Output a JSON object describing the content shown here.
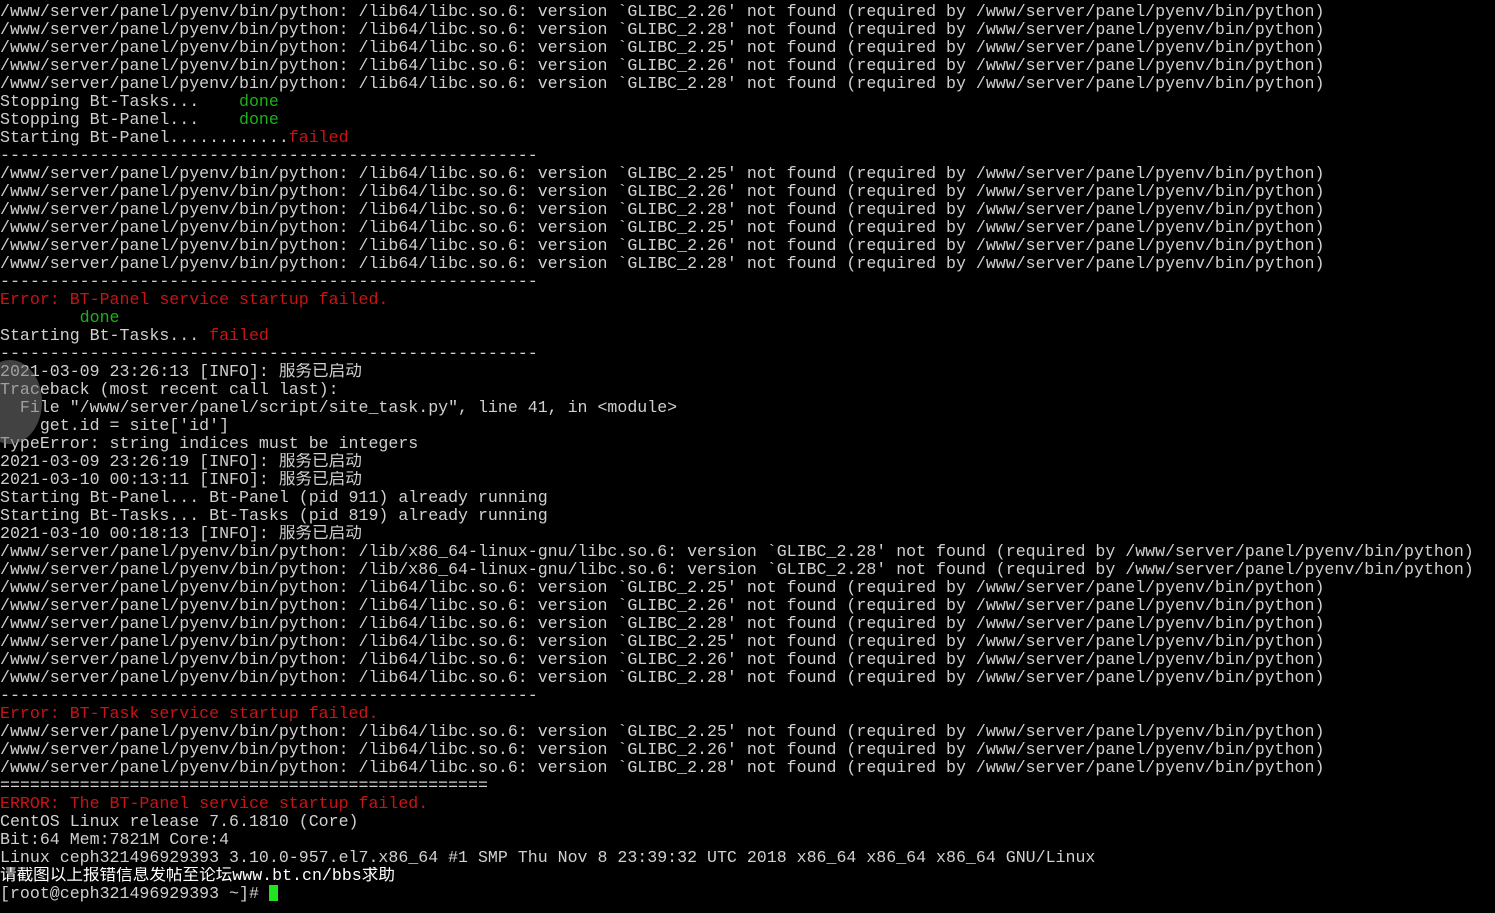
{
  "terminal": {
    "prompt": "[root@ceph321496929393 ~]# ",
    "lines": [
      [
        {
          "t": "/www/server/panel/pyenv/bin/python: /lib64/libc.so.6: version `GLIBC_2.26' not found (required by /www/server/panel/pyenv/bin/python)",
          "c": "default"
        }
      ],
      [
        {
          "t": "/www/server/panel/pyenv/bin/python: /lib64/libc.so.6: version `GLIBC_2.28' not found (required by /www/server/panel/pyenv/bin/python)",
          "c": "default"
        }
      ],
      [
        {
          "t": "/www/server/panel/pyenv/bin/python: /lib64/libc.so.6: version `GLIBC_2.25' not found (required by /www/server/panel/pyenv/bin/python)",
          "c": "default"
        }
      ],
      [
        {
          "t": "/www/server/panel/pyenv/bin/python: /lib64/libc.so.6: version `GLIBC_2.26' not found (required by /www/server/panel/pyenv/bin/python)",
          "c": "default"
        }
      ],
      [
        {
          "t": "/www/server/panel/pyenv/bin/python: /lib64/libc.so.6: version `GLIBC_2.28' not found (required by /www/server/panel/pyenv/bin/python)",
          "c": "default"
        }
      ],
      [
        {
          "t": "Stopping Bt-Tasks...    ",
          "c": "default"
        },
        {
          "t": "done",
          "c": "green"
        }
      ],
      [
        {
          "t": "Stopping Bt-Panel...    ",
          "c": "default"
        },
        {
          "t": "done",
          "c": "green"
        }
      ],
      [
        {
          "t": "Starting Bt-Panel............",
          "c": "default"
        },
        {
          "t": "failed",
          "c": "red"
        }
      ],
      [
        {
          "t": "------------------------------------------------------",
          "c": "default"
        }
      ],
      [
        {
          "t": "/www/server/panel/pyenv/bin/python: /lib64/libc.so.6: version `GLIBC_2.25' not found (required by /www/server/panel/pyenv/bin/python)",
          "c": "default"
        }
      ],
      [
        {
          "t": "/www/server/panel/pyenv/bin/python: /lib64/libc.so.6: version `GLIBC_2.26' not found (required by /www/server/panel/pyenv/bin/python)",
          "c": "default"
        }
      ],
      [
        {
          "t": "/www/server/panel/pyenv/bin/python: /lib64/libc.so.6: version `GLIBC_2.28' not found (required by /www/server/panel/pyenv/bin/python)",
          "c": "default"
        }
      ],
      [
        {
          "t": "/www/server/panel/pyenv/bin/python: /lib64/libc.so.6: version `GLIBC_2.25' not found (required by /www/server/panel/pyenv/bin/python)",
          "c": "default"
        }
      ],
      [
        {
          "t": "/www/server/panel/pyenv/bin/python: /lib64/libc.so.6: version `GLIBC_2.26' not found (required by /www/server/panel/pyenv/bin/python)",
          "c": "default"
        }
      ],
      [
        {
          "t": "/www/server/panel/pyenv/bin/python: /lib64/libc.so.6: version `GLIBC_2.28' not found (required by /www/server/panel/pyenv/bin/python)",
          "c": "default"
        }
      ],
      [
        {
          "t": "------------------------------------------------------",
          "c": "default"
        }
      ],
      [
        {
          "t": "Error: BT-Panel service startup failed.",
          "c": "red"
        }
      ],
      [
        {
          "t": "        ",
          "c": "default"
        },
        {
          "t": "done",
          "c": "green"
        }
      ],
      [
        {
          "t": "Starting Bt-Tasks... ",
          "c": "default"
        },
        {
          "t": "failed",
          "c": "red"
        }
      ],
      [
        {
          "t": "------------------------------------------------------",
          "c": "default"
        }
      ],
      [
        {
          "t": "2021-03-09 23:26:13 [INFO]: 服务已启动",
          "c": "default"
        }
      ],
      [
        {
          "t": "Traceback (most recent call last):",
          "c": "default"
        }
      ],
      [
        {
          "t": "  File \"/www/server/panel/script/site_task.py\", line 41, in <module>",
          "c": "default"
        }
      ],
      [
        {
          "t": "    get.id = site['id']",
          "c": "default"
        }
      ],
      [
        {
          "t": "TypeError: string indices must be integers",
          "c": "default"
        }
      ],
      [
        {
          "t": "2021-03-09 23:26:19 [INFO]: 服务已启动",
          "c": "default"
        }
      ],
      [
        {
          "t": "2021-03-10 00:13:11 [INFO]: 服务已启动",
          "c": "default"
        }
      ],
      [
        {
          "t": "Starting Bt-Panel... Bt-Panel (pid 911) already running",
          "c": "default"
        }
      ],
      [
        {
          "t": "Starting Bt-Tasks... Bt-Tasks (pid 819) already running",
          "c": "default"
        }
      ],
      [
        {
          "t": "2021-03-10 00:18:13 [INFO]: 服务已启动",
          "c": "default"
        }
      ],
      [
        {
          "t": "/www/server/panel/pyenv/bin/python: /lib/x86_64-linux-gnu/libc.so.6: version `GLIBC_2.28' not found (required by /www/server/panel/pyenv/bin/python)",
          "c": "default"
        }
      ],
      [
        {
          "t": "/www/server/panel/pyenv/bin/python: /lib/x86_64-linux-gnu/libc.so.6: version `GLIBC_2.28' not found (required by /www/server/panel/pyenv/bin/python)",
          "c": "default"
        }
      ],
      [
        {
          "t": "/www/server/panel/pyenv/bin/python: /lib64/libc.so.6: version `GLIBC_2.25' not found (required by /www/server/panel/pyenv/bin/python)",
          "c": "default"
        }
      ],
      [
        {
          "t": "/www/server/panel/pyenv/bin/python: /lib64/libc.so.6: version `GLIBC_2.26' not found (required by /www/server/panel/pyenv/bin/python)",
          "c": "default"
        }
      ],
      [
        {
          "t": "/www/server/panel/pyenv/bin/python: /lib64/libc.so.6: version `GLIBC_2.28' not found (required by /www/server/panel/pyenv/bin/python)",
          "c": "default"
        }
      ],
      [
        {
          "t": "/www/server/panel/pyenv/bin/python: /lib64/libc.so.6: version `GLIBC_2.25' not found (required by /www/server/panel/pyenv/bin/python)",
          "c": "default"
        }
      ],
      [
        {
          "t": "/www/server/panel/pyenv/bin/python: /lib64/libc.so.6: version `GLIBC_2.26' not found (required by /www/server/panel/pyenv/bin/python)",
          "c": "default"
        }
      ],
      [
        {
          "t": "/www/server/panel/pyenv/bin/python: /lib64/libc.so.6: version `GLIBC_2.28' not found (required by /www/server/panel/pyenv/bin/python)",
          "c": "default"
        }
      ],
      [
        {
          "t": "------------------------------------------------------",
          "c": "default"
        }
      ],
      [
        {
          "t": "Error: BT-Task service startup failed.",
          "c": "red"
        }
      ],
      [
        {
          "t": "/www/server/panel/pyenv/bin/python: /lib64/libc.so.6: version `GLIBC_2.25' not found (required by /www/server/panel/pyenv/bin/python)",
          "c": "default"
        }
      ],
      [
        {
          "t": "/www/server/panel/pyenv/bin/python: /lib64/libc.so.6: version `GLIBC_2.26' not found (required by /www/server/panel/pyenv/bin/python)",
          "c": "default"
        }
      ],
      [
        {
          "t": "/www/server/panel/pyenv/bin/python: /lib64/libc.so.6: version `GLIBC_2.28' not found (required by /www/server/panel/pyenv/bin/python)",
          "c": "default"
        }
      ],
      [
        {
          "t": "=================================================",
          "c": "default"
        }
      ],
      [
        {
          "t": "ERROR: The BT-Panel service startup failed.",
          "c": "red"
        }
      ],
      [
        {
          "t": "CentOS Linux release 7.6.1810 (Core)",
          "c": "default"
        }
      ],
      [
        {
          "t": "Bit:64 Mem:7821M Core:4",
          "c": "default"
        }
      ],
      [
        {
          "t": "Linux ceph321496929393 3.10.0-957.el7.x86_64 #1 SMP Thu Nov 8 23:39:32 UTC 2018 x86_64 x86_64 x86_64 GNU/Linux",
          "c": "default"
        }
      ],
      [
        {
          "t": "请截图以上报错信息发帖至论坛www.bt.cn/bbs求助",
          "c": "white"
        }
      ]
    ],
    "colors": {
      "background": "#000000",
      "default": "#d0d0d0",
      "green": "#19b219",
      "red": "#c81414",
      "cursor": "#22e022"
    }
  }
}
